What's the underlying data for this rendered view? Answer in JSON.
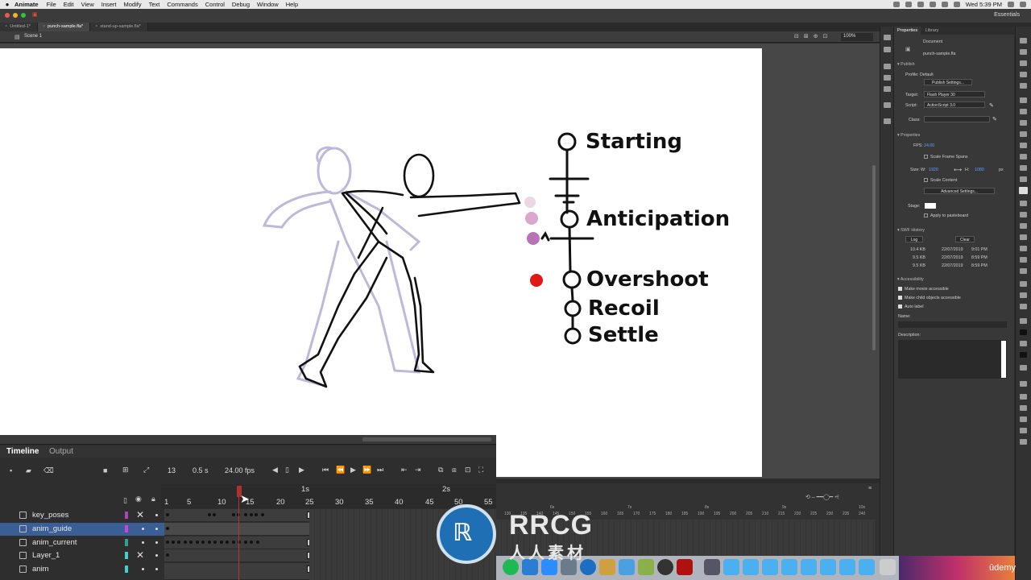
{
  "menubar": {
    "apple": "",
    "app_name": "Animate",
    "items": [
      "File",
      "Edit",
      "View",
      "Insert",
      "Modify",
      "Text",
      "Commands",
      "Control",
      "Debug",
      "Window",
      "Help"
    ],
    "clock": "Wed 5:39 PM"
  },
  "appbar": {
    "workspace": "Essentials"
  },
  "doc_tabs": [
    "Untitled-1*",
    "punch-sample.fla*",
    "stand-up-sample.fla*"
  ],
  "scene": {
    "label": "Scene 1",
    "zoom": "100%"
  },
  "stage_drawing": {
    "labels": [
      "Starting",
      "Anticipation",
      "Overshoot",
      "Recoil",
      "Settle"
    ],
    "colors": {
      "dot_pale": "#e6c8dc",
      "dot_mid": "#d49ac4",
      "dot_dark": "#b86ab0",
      "dot_red": "#e01818"
    }
  },
  "properties": {
    "tabs": [
      "Properties",
      "Library"
    ],
    "document_type": "Document",
    "file_name": "punch-sample.fla",
    "publish": {
      "header": "Publish",
      "profile": "Profile: Default",
      "settings_button": "Publish Settings...",
      "target_label": "Target:",
      "target_value": "Flash Player 30",
      "script_label": "Script:",
      "script_value": "ActionScript 3.0",
      "class_label": "Class:"
    },
    "props": {
      "header": "Properties",
      "fps_label": "FPS:",
      "fps_value": "24.00",
      "scale_spans": "Scale Frame Spans",
      "size_label": "Size:",
      "w_label": "W:",
      "w_value": "1920",
      "h_label": "H:",
      "h_value": "1080",
      "unit": "px",
      "scale_content": "Scale Content",
      "advanced_button": "Advanced Settings...",
      "stage_label": "Stage:",
      "apply_pasteboard": "Apply to pasteboard"
    },
    "swf_history": {
      "header": "SWF History",
      "log_button": "Log",
      "clear_button": "Clear",
      "rows": [
        {
          "size": "10.4 KB",
          "date": "22/07/2019",
          "time": "9:01 PM"
        },
        {
          "size": "9.5 KB",
          "date": "22/07/2019",
          "time": "8:59 PM"
        },
        {
          "size": "9.5 KB",
          "date": "22/07/2019",
          "time": "8:59 PM"
        }
      ]
    },
    "accessibility": {
      "header": "Accessibility",
      "make_movie": "Make movie accessible",
      "make_child": "Make child objects accessible",
      "auto_label": "Auto label",
      "name_label": "Name:",
      "description_label": "Description:"
    }
  },
  "timeline": {
    "tabs": [
      "Timeline",
      "Output"
    ],
    "current_frame": "13",
    "elapsed": "0.5 s",
    "fps": "24.00 fps",
    "ruler_seconds": [
      "1s",
      "2s"
    ],
    "ruler_frames": [
      "1",
      "5",
      "10",
      "15",
      "20",
      "25",
      "30",
      "35",
      "40",
      "45",
      "50",
      "55"
    ],
    "layers": [
      {
        "name": "key_poses",
        "color": "#b040c0",
        "selected": false,
        "hidden": true
      },
      {
        "name": "anim_guide",
        "color": "#d040e0",
        "selected": true,
        "hidden": false
      },
      {
        "name": "anim_current",
        "color": "#30a090",
        "selected": false,
        "hidden": false
      },
      {
        "name": "Layer_1",
        "color": "#40d0d0",
        "selected": false,
        "hidden": true
      },
      {
        "name": "anim",
        "color": "#40d0d0",
        "selected": false,
        "hidden": false
      }
    ],
    "ext_seconds": [
      "6s",
      "7s",
      "8s",
      "9s",
      "10s"
    ],
    "ext_frames": [
      "130",
      "135",
      "140",
      "145",
      "150",
      "155",
      "160",
      "165",
      "170",
      "175",
      "180",
      "185",
      "190",
      "195",
      "200",
      "205",
      "210",
      "215",
      "220",
      "225",
      "230",
      "235",
      "240"
    ]
  },
  "dock": {
    "udemy": "ûdemy"
  },
  "watermark": {
    "brand": "RRCG",
    "sub": "人人素材"
  }
}
